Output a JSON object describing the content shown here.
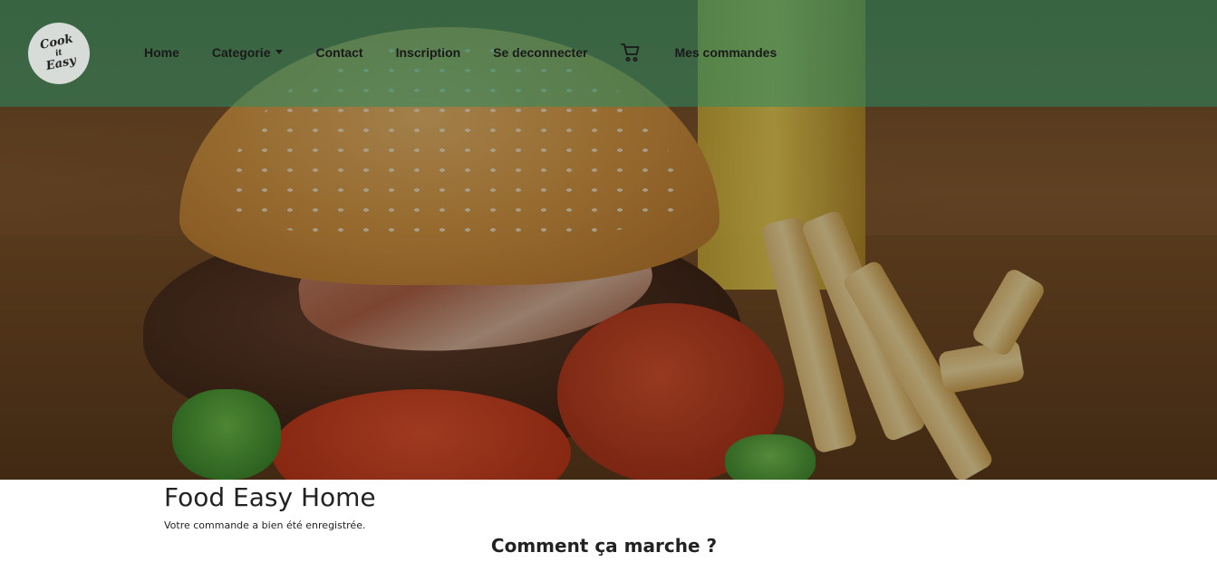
{
  "brand": {
    "logo_line1": "Cook",
    "logo_line2": "it",
    "logo_line3": "Easy"
  },
  "nav": {
    "home": "Home",
    "categorie": "Categorie",
    "contact": "Contact",
    "inscription": "Inscription",
    "deconnecter": "Se deconnecter",
    "cart_icon": "shopping-cart-icon",
    "commandes": "Mes commandes"
  },
  "main": {
    "title": "Food Easy Home",
    "message": "Votre commande a bien été enregistrée.",
    "section_title": "Comment ça marche ?"
  },
  "colors": {
    "navbar_overlay": "rgba(40,140,100,0.55)",
    "text": "#222222"
  }
}
